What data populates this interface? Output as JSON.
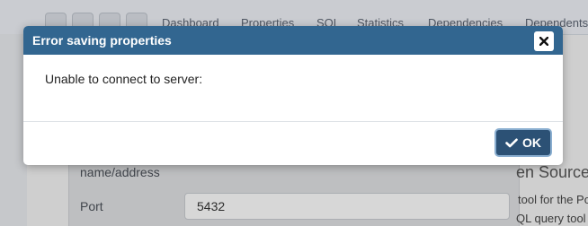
{
  "background": {
    "tabs": [
      "Dashboard",
      "Properties",
      "SQL",
      "Statistics",
      "Dependencies",
      "Dependents"
    ],
    "fields": {
      "host_label_tail": "name/address",
      "port_label": "Port",
      "port_value": "5432"
    },
    "side_heading": "en Source",
    "side_lines": [
      "tool for the Po",
      "QL query tool"
    ]
  },
  "dialog": {
    "title": "Error saving properties",
    "message": "Unable to connect to server:",
    "ok_label": "OK"
  },
  "colors": {
    "header": "#326690",
    "ok_button": "#2c5175"
  }
}
